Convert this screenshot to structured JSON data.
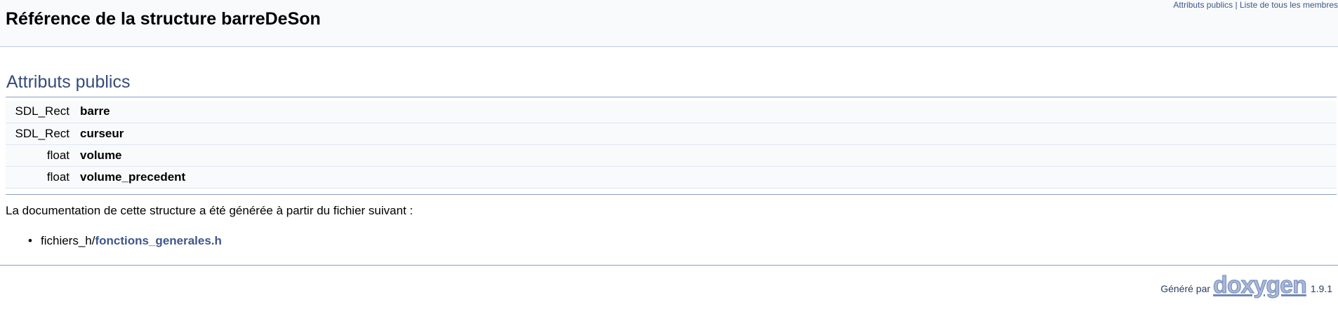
{
  "header": {
    "title": "Référence de la structure barreDeSon",
    "summary_links": {
      "public_attributes": "Attributs publics",
      "separator": "|",
      "all_members": "Liste de tous les membres"
    }
  },
  "section": {
    "heading": "Attributs publics",
    "members": [
      {
        "type": "SDL_Rect",
        "name": "barre"
      },
      {
        "type": "SDL_Rect",
        "name": "curseur"
      },
      {
        "type": "float",
        "name": "volume"
      },
      {
        "type": "float",
        "name": "volume_precedent"
      }
    ]
  },
  "documentation": {
    "intro": "La documentation de cette structure a été générée à partir du fichier suivant :",
    "files": [
      {
        "dir": "fichiers_h/",
        "name": "fonctions_generales.h"
      }
    ]
  },
  "footer": {
    "generated_by": "Généré par",
    "logo_text": "doxygen",
    "version": "1.9.1"
  },
  "colors": {
    "link": "#3d578c",
    "heading": "#354c7b",
    "rule": "#879ecb",
    "header_bg": "#f9fafc"
  }
}
